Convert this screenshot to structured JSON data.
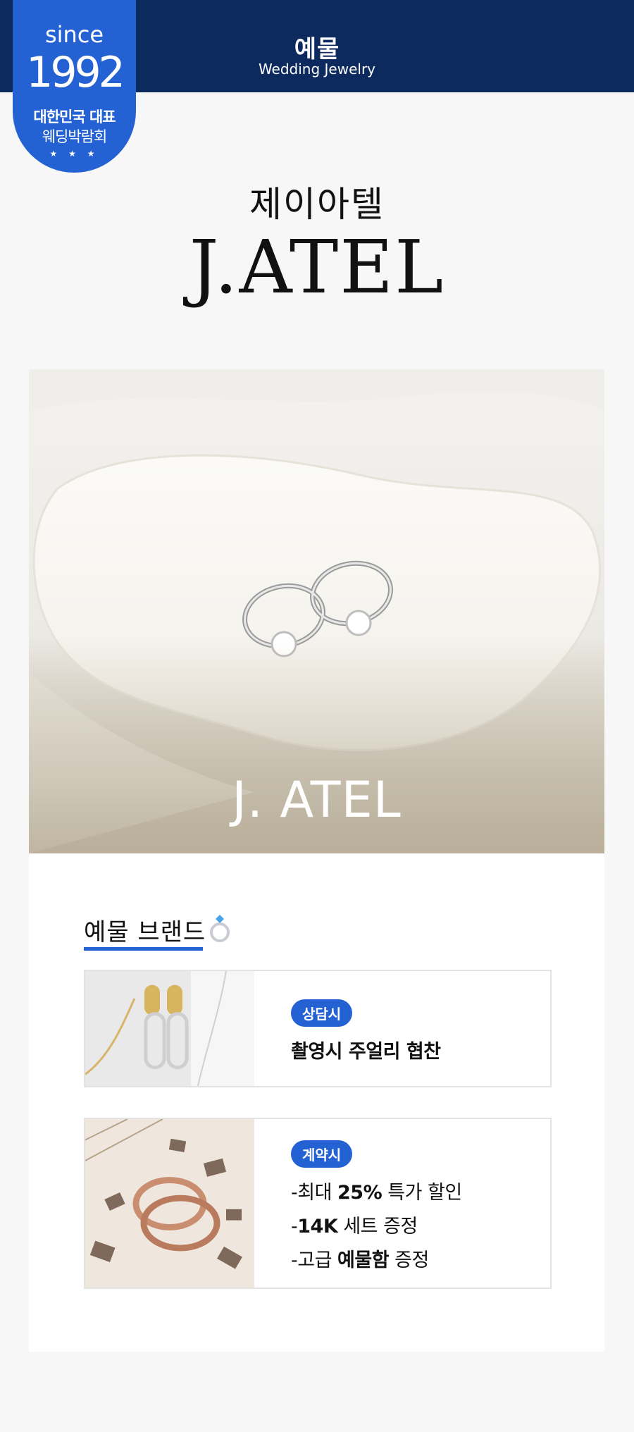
{
  "header": {
    "category_ko": "예물",
    "category_en": "Wedding Jewelry"
  },
  "badge": {
    "since": "since",
    "year": "1992",
    "line1": "대한민국 대표",
    "line2": "웨딩박람회",
    "stars": "★ ★ ★"
  },
  "brand": {
    "name_ko": "제이아텔",
    "name_en": "J.ATEL"
  },
  "hero": {
    "watermark": "J. ATEL"
  },
  "section": {
    "title": "예물 브랜드"
  },
  "benefits": [
    {
      "tag": "상담시",
      "lines": [
        {
          "text": "촬영시 주얼리 협찬"
        }
      ]
    },
    {
      "tag": "계약시",
      "lines": [
        {
          "pre": "-최대 ",
          "bold": "25%",
          "post": " 특가 할인"
        },
        {
          "pre": "-",
          "bold": "14K",
          "post": " 세트 증정"
        },
        {
          "pre": "-고급 ",
          "bold": "예물함",
          "post": " 증정"
        }
      ]
    }
  ],
  "colors": {
    "navy": "#0d2a5e",
    "accent": "#2462d4"
  }
}
